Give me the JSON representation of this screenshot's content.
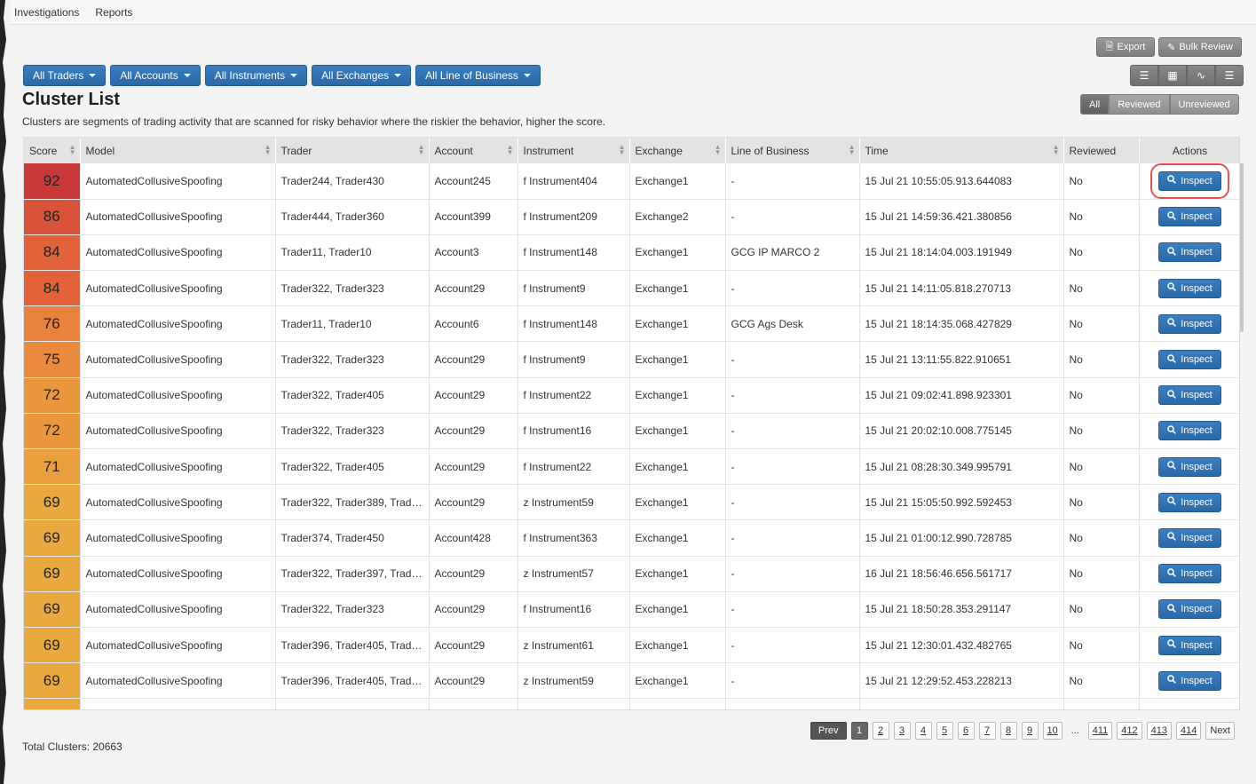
{
  "nav": {
    "investigations": "Investigations",
    "reports": "Reports"
  },
  "toolbar": {
    "export": "Export",
    "bulk_review": "Bulk Review"
  },
  "filters": [
    "All Traders",
    "All Accounts",
    "All Instruments",
    "All Exchanges",
    "All Line of Business"
  ],
  "page": {
    "title": "Cluster List",
    "subtitle": "Clusters are segments of trading activity that are scanned for risky behavior where the riskier the behavior, higher the score."
  },
  "review_filter": {
    "all": "All",
    "reviewed": "Reviewed",
    "unreviewed": "Unreviewed"
  },
  "table": {
    "headers": [
      "Score",
      "Model",
      "Trader",
      "Account",
      "Instrument",
      "Exchange",
      "Line of Business",
      "Time",
      "Reviewed",
      "Actions"
    ],
    "action_label": "Inspect",
    "score_colors": {
      "92": "#c9393a",
      "86": "#d9533b",
      "84": "#e2623a",
      "76": "#e8823d",
      "75": "#e98a3d",
      "72": "#ea963d",
      "71": "#eb9e3e",
      "69": "#eaa93f"
    },
    "rows": [
      [
        "92",
        "AutomatedCollusiveSpoofing",
        "Trader244, Trader430",
        "Account245",
        "f Instrument404",
        "Exchange1",
        "-",
        "15 Jul 21 10:55:05.913.644083",
        "No"
      ],
      [
        "86",
        "AutomatedCollusiveSpoofing",
        "Trader444, Trader360",
        "Account399",
        "f Instrument209",
        "Exchange2",
        "-",
        "15 Jul 21 14:59:36.421.380856",
        "No"
      ],
      [
        "84",
        "AutomatedCollusiveSpoofing",
        "Trader11, Trader10",
        "Account3",
        "f Instrument148",
        "Exchange1",
        "GCG IP MARCO 2",
        "15 Jul 21 18:14:04.003.191949",
        "No"
      ],
      [
        "84",
        "AutomatedCollusiveSpoofing",
        "Trader322, Trader323",
        "Account29",
        "f Instrument9",
        "Exchange1",
        "-",
        "15 Jul 21 14:11:05.818.270713",
        "No"
      ],
      [
        "76",
        "AutomatedCollusiveSpoofing",
        "Trader11, Trader10",
        "Account6",
        "f Instrument148",
        "Exchange1",
        "GCG Ags Desk",
        "15 Jul 21 18:14:35.068.427829",
        "No"
      ],
      [
        "75",
        "AutomatedCollusiveSpoofing",
        "Trader322, Trader323",
        "Account29",
        "f Instrument9",
        "Exchange1",
        "-",
        "15 Jul 21 13:11:55.822.910651",
        "No"
      ],
      [
        "72",
        "AutomatedCollusiveSpoofing",
        "Trader322, Trader405",
        "Account29",
        "f Instrument22",
        "Exchange1",
        "-",
        "15 Jul 21 09:02:41.898.923301",
        "No"
      ],
      [
        "72",
        "AutomatedCollusiveSpoofing",
        "Trader322, Trader323",
        "Account29",
        "f Instrument16",
        "Exchange1",
        "-",
        "15 Jul 21 20:02:10.008.775145",
        "No"
      ],
      [
        "71",
        "AutomatedCollusiveSpoofing",
        "Trader322, Trader405",
        "Account29",
        "f Instrument22",
        "Exchange1",
        "-",
        "15 Jul 21 08:28:30.349.995791",
        "No"
      ],
      [
        "69",
        "AutomatedCollusiveSpoofing",
        "Trader322, Trader389, Trader…",
        "Account29",
        "z Instrument59",
        "Exchange1",
        "-",
        "15 Jul 21 15:05:50.992.592453",
        "No"
      ],
      [
        "69",
        "AutomatedCollusiveSpoofing",
        "Trader374, Trader450",
        "Account428",
        "f Instrument363",
        "Exchange1",
        "-",
        "15 Jul 21 01:00:12.990.728785",
        "No"
      ],
      [
        "69",
        "AutomatedCollusiveSpoofing",
        "Trader322, Trader397, Trader…",
        "Account29",
        "z Instrument57",
        "Exchange1",
        "-",
        "16 Jul 21 18:56:46.656.561717",
        "No"
      ],
      [
        "69",
        "AutomatedCollusiveSpoofing",
        "Trader322, Trader323",
        "Account29",
        "f Instrument16",
        "Exchange1",
        "-",
        "15 Jul 21 18:50:28.353.291147",
        "No"
      ],
      [
        "69",
        "AutomatedCollusiveSpoofing",
        "Trader396, Trader405, Trader…",
        "Account29",
        "z Instrument61",
        "Exchange1",
        "-",
        "15 Jul 21 12:30:01.432.482765",
        "No"
      ],
      [
        "69",
        "AutomatedCollusiveSpoofing",
        "Trader396, Trader405, Trader…",
        "Account29",
        "z Instrument59",
        "Exchange1",
        "-",
        "15 Jul 21 12:29:52.453.228213",
        "No"
      ]
    ]
  },
  "pagination": {
    "prev": "Prev",
    "next": "Next",
    "ellipsis": "...",
    "pages": [
      "1",
      "2",
      "3",
      "4",
      "5",
      "6",
      "7",
      "8",
      "9",
      "10"
    ],
    "last_pages": [
      "411",
      "412",
      "413",
      "414"
    ],
    "current": "1"
  },
  "footer": {
    "total": "Total Clusters: 20663"
  }
}
